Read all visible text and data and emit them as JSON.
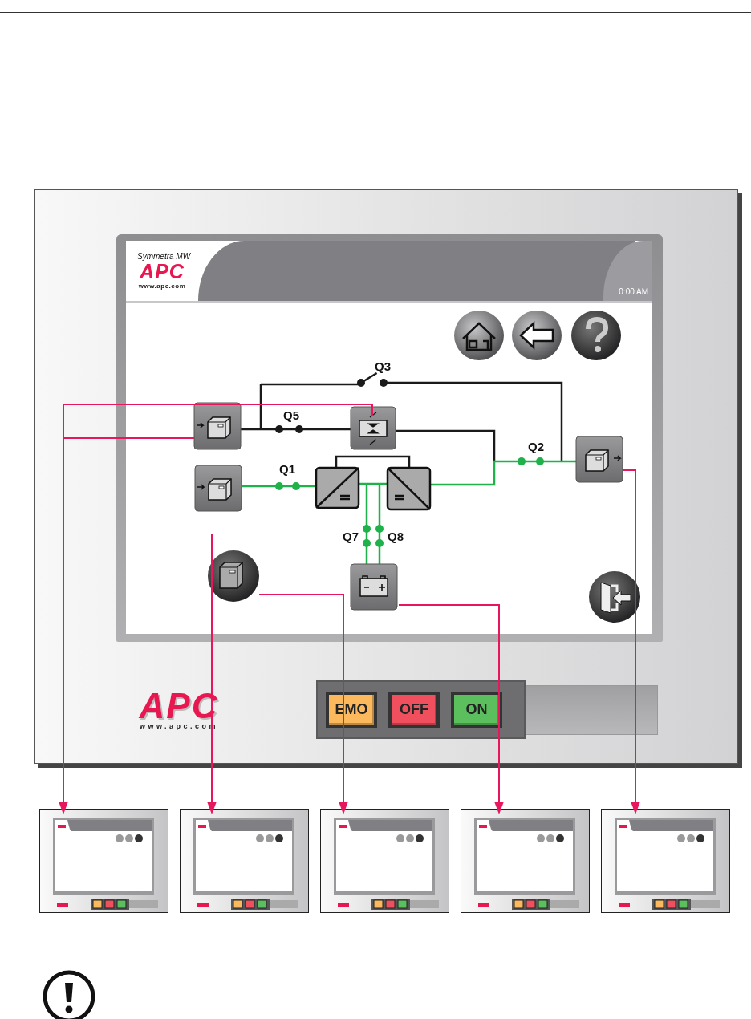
{
  "screen": {
    "product": "Symmetra MW",
    "logo": "APC",
    "url": "www.apc.com",
    "time": "0:00 AM"
  },
  "diagram": {
    "switches": [
      {
        "label": "Q3",
        "closed": false,
        "energized": false
      },
      {
        "label": "Q5",
        "closed": true,
        "energized": false
      },
      {
        "label": "Q1",
        "closed": true,
        "energized": true
      },
      {
        "label": "Q2",
        "closed": true,
        "energized": true
      },
      {
        "label": "Q7",
        "closed": true,
        "energized": true
      },
      {
        "label": "Q8",
        "closed": true,
        "energized": true
      }
    ]
  },
  "front_panel": {
    "logo": "APC",
    "url": "www.apc.com",
    "buttons": [
      {
        "label": "EMO",
        "color": "#fbb85c"
      },
      {
        "label": "OFF",
        "color": "#f0505e"
      },
      {
        "label": "ON",
        "color": "#5cbf5e"
      }
    ]
  },
  "thumbnails": [
    {
      "kind": "screen"
    },
    {
      "kind": "screen"
    },
    {
      "kind": "screen"
    },
    {
      "kind": "screen"
    },
    {
      "kind": "screen"
    }
  ]
}
